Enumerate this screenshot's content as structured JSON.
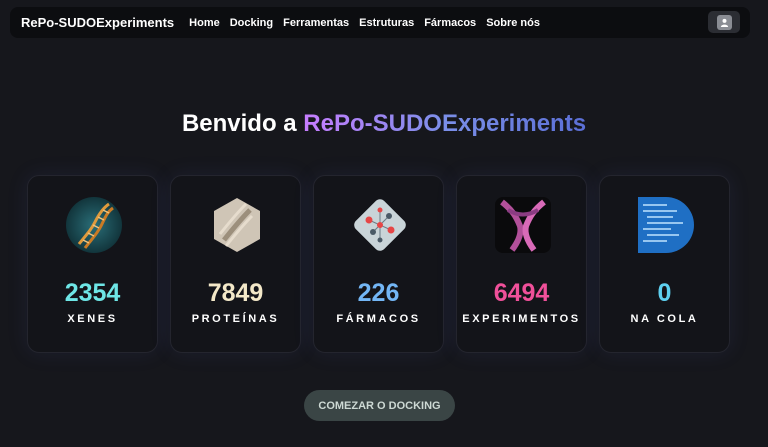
{
  "navbar": {
    "brand": "RePo-SUDOExperiments",
    "items": [
      {
        "label": "Home"
      },
      {
        "label": "Docking"
      },
      {
        "label": "Ferramentas"
      },
      {
        "label": "Estruturas"
      },
      {
        "label": "Fármacos"
      },
      {
        "label": "Sobre nós"
      }
    ],
    "user_icon": "user-icon"
  },
  "hero": {
    "title_prefix": "Benvido a ",
    "title_highlight": "RePo-SUDOExperiments"
  },
  "stats": [
    {
      "value": "2354",
      "label": "XENES",
      "color": "#6ee6e6",
      "image": "dna-helix-image"
    },
    {
      "value": "7849",
      "label": "PROTEÍNAS",
      "color": "#f3e8c8",
      "image": "protein-hexagon-image"
    },
    {
      "value": "226",
      "label": "FÁRMACOS",
      "color": "#73b6f5",
      "image": "molecule-image"
    },
    {
      "value": "6494",
      "label": "EXPERIMENTOS",
      "color": "#f0509a",
      "image": "experiment-image"
    },
    {
      "value": "0",
      "label": "NA COLA",
      "color": "#5ed0f0",
      "image": "code-screen-image"
    }
  ],
  "cta": {
    "label": "COMEZAR O DOCKING"
  }
}
